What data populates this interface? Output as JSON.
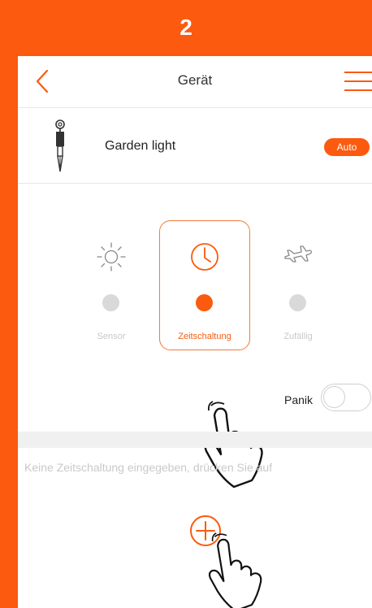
{
  "step": {
    "number": "2"
  },
  "header": {
    "title": "Gerät",
    "back_icon": "chevron-left-icon",
    "menu_icon": "hamburger-icon"
  },
  "device": {
    "name": "Garden light",
    "mode_badge": "Auto",
    "icon": "garden-light-icon"
  },
  "modes": [
    {
      "label": "Sensor",
      "icon": "sun-icon",
      "selected": false
    },
    {
      "label": "Zeitschaltung",
      "icon": "clock-icon",
      "selected": true
    },
    {
      "label": "Zufällig",
      "icon": "airplane-icon",
      "selected": false
    }
  ],
  "panic": {
    "label": "Panik",
    "enabled": false
  },
  "schedule": {
    "empty_message": "Keine Zeitschaltung eingegeben, drücken Sie auf",
    "add_icon": "plus-circle-icon"
  },
  "colors": {
    "accent": "#fb5a0f",
    "inactive": "#d9d9d9"
  }
}
